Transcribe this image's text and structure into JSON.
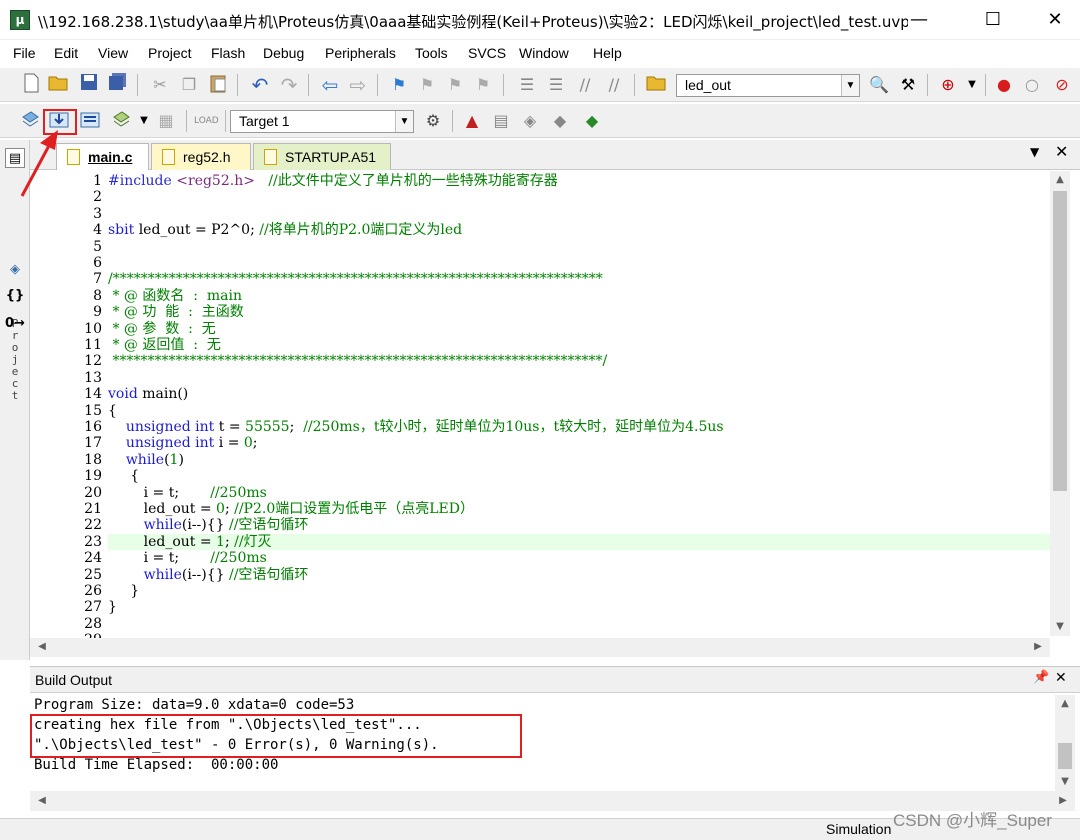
{
  "window": {
    "title": "\\\\192.168.238.1\\study\\aa单片机\\Proteus仿真\\0aaa基础实验例程(Keil+Proteus)\\实验2：LED闪烁\\keil_project\\led_test.uvp...",
    "minimize": "—",
    "maximize": "☐",
    "close": "✕"
  },
  "menu": [
    "File",
    "Edit",
    "View",
    "Project",
    "Flash",
    "Debug",
    "Peripherals",
    "Tools",
    "SVCS",
    "Window",
    "Help"
  ],
  "toolbar1": {
    "find_combo_value": "led_out"
  },
  "toolbar2": {
    "target_combo_value": "Target 1"
  },
  "left_strip": {
    "project_label": "Project"
  },
  "tabs": [
    {
      "label": "main.c",
      "active": true
    },
    {
      "label": "reg52.h",
      "active": false
    },
    {
      "label": "STARTUP.A51",
      "active": false
    }
  ],
  "editor": {
    "current_line": 23,
    "lines": [
      {
        "n": "1",
        "tokens": [
          [
            "pp",
            "#include "
          ],
          [
            "str",
            "<reg52.h>"
          ],
          [
            "plain",
            "   "
          ],
          [
            "cmt",
            "//此文件中定义了单片机的一些特殊功能寄存器"
          ]
        ]
      },
      {
        "n": "2",
        "tokens": []
      },
      {
        "n": "3",
        "tokens": []
      },
      {
        "n": "4",
        "tokens": [
          [
            "kw",
            "sbit"
          ],
          [
            "plain",
            " led_out = P2^0; "
          ],
          [
            "cmt",
            "//将单片机的P2.0端口定义为led"
          ]
        ]
      },
      {
        "n": "5",
        "tokens": []
      },
      {
        "n": "6",
        "tokens": []
      },
      {
        "n": "7",
        "tokens": [
          [
            "cmt",
            "/**********************************************************************"
          ]
        ]
      },
      {
        "n": "8",
        "tokens": [
          [
            "cmt",
            " * @ 函数名  :  main"
          ]
        ]
      },
      {
        "n": "9",
        "tokens": [
          [
            "cmt",
            " * @ 功  能  :  主函数"
          ]
        ]
      },
      {
        "n": "10",
        "tokens": [
          [
            "cmt",
            " * @ 参  数  :  无"
          ]
        ]
      },
      {
        "n": "11",
        "tokens": [
          [
            "cmt",
            " * @ 返回值  :  无"
          ]
        ]
      },
      {
        "n": "12",
        "tokens": [
          [
            "cmt",
            " **********************************************************************/"
          ]
        ]
      },
      {
        "n": "13",
        "tokens": []
      },
      {
        "n": "14",
        "tokens": [
          [
            "kw",
            "void"
          ],
          [
            "plain",
            " main()"
          ]
        ]
      },
      {
        "n": "15",
        "tokens": [
          [
            "plain",
            "{"
          ]
        ]
      },
      {
        "n": "16",
        "tokens": [
          [
            "plain",
            "    "
          ],
          [
            "kw",
            "unsigned int"
          ],
          [
            "plain",
            " t = "
          ],
          [
            "num",
            "55555"
          ],
          [
            "plain",
            ";  "
          ],
          [
            "cmt",
            "//250ms，t较小时，延时单位为10us，t较大时，延时单位为4.5us"
          ]
        ]
      },
      {
        "n": "17",
        "tokens": [
          [
            "plain",
            "    "
          ],
          [
            "kw",
            "unsigned int"
          ],
          [
            "plain",
            " i = "
          ],
          [
            "num",
            "0"
          ],
          [
            "plain",
            ";"
          ]
        ]
      },
      {
        "n": "18",
        "tokens": [
          [
            "plain",
            "    "
          ],
          [
            "kw",
            "while"
          ],
          [
            "plain",
            "("
          ],
          [
            "num",
            "1"
          ],
          [
            "plain",
            ")"
          ]
        ]
      },
      {
        "n": "19",
        "tokens": [
          [
            "plain",
            "     {"
          ]
        ]
      },
      {
        "n": "20",
        "tokens": [
          [
            "plain",
            "        i = t;       "
          ],
          [
            "cmt",
            "//250ms"
          ]
        ]
      },
      {
        "n": "21",
        "tokens": [
          [
            "plain",
            "        led_out = "
          ],
          [
            "num",
            "0"
          ],
          [
            "plain",
            "; "
          ],
          [
            "cmt",
            "//P2.0端口设置为低电平（点亮LED）"
          ]
        ]
      },
      {
        "n": "22",
        "tokens": [
          [
            "plain",
            "        "
          ],
          [
            "kw",
            "while"
          ],
          [
            "plain",
            "(i--){} "
          ],
          [
            "cmt",
            "//空语句循环"
          ]
        ]
      },
      {
        "n": "23",
        "tokens": [
          [
            "plain",
            "        led_out = "
          ],
          [
            "num",
            "1"
          ],
          [
            "plain",
            "; "
          ],
          [
            "cmt",
            "//灯灭"
          ]
        ]
      },
      {
        "n": "24",
        "tokens": [
          [
            "plain",
            "        i = t;       "
          ],
          [
            "cmt",
            "//250ms"
          ]
        ]
      },
      {
        "n": "25",
        "tokens": [
          [
            "plain",
            "        "
          ],
          [
            "kw",
            "while"
          ],
          [
            "plain",
            "(i--){} "
          ],
          [
            "cmt",
            "//空语句循环"
          ]
        ]
      },
      {
        "n": "26",
        "tokens": [
          [
            "plain",
            "     }"
          ]
        ]
      },
      {
        "n": "27",
        "tokens": [
          [
            "plain",
            "}"
          ]
        ]
      },
      {
        "n": "28",
        "tokens": []
      },
      {
        "n": "29",
        "tokens": []
      }
    ]
  },
  "build_output": {
    "title": "Build Output",
    "lines": [
      "Program Size: data=9.0 xdata=0 code=53",
      "creating hex file from \".\\Objects\\led_test\"...",
      "\".\\Objects\\led_test\" - 0 Error(s), 0 Warning(s).",
      "Build Time Elapsed:  00:00:00"
    ]
  },
  "status": {
    "mode": "Simulation"
  },
  "watermark": "CSDN @小辉_Super",
  "colors": {
    "annotation": "#e02020",
    "current_line_bg": "#e6ffe6",
    "comment": "#008000",
    "keyword": "#1b1bd9"
  }
}
